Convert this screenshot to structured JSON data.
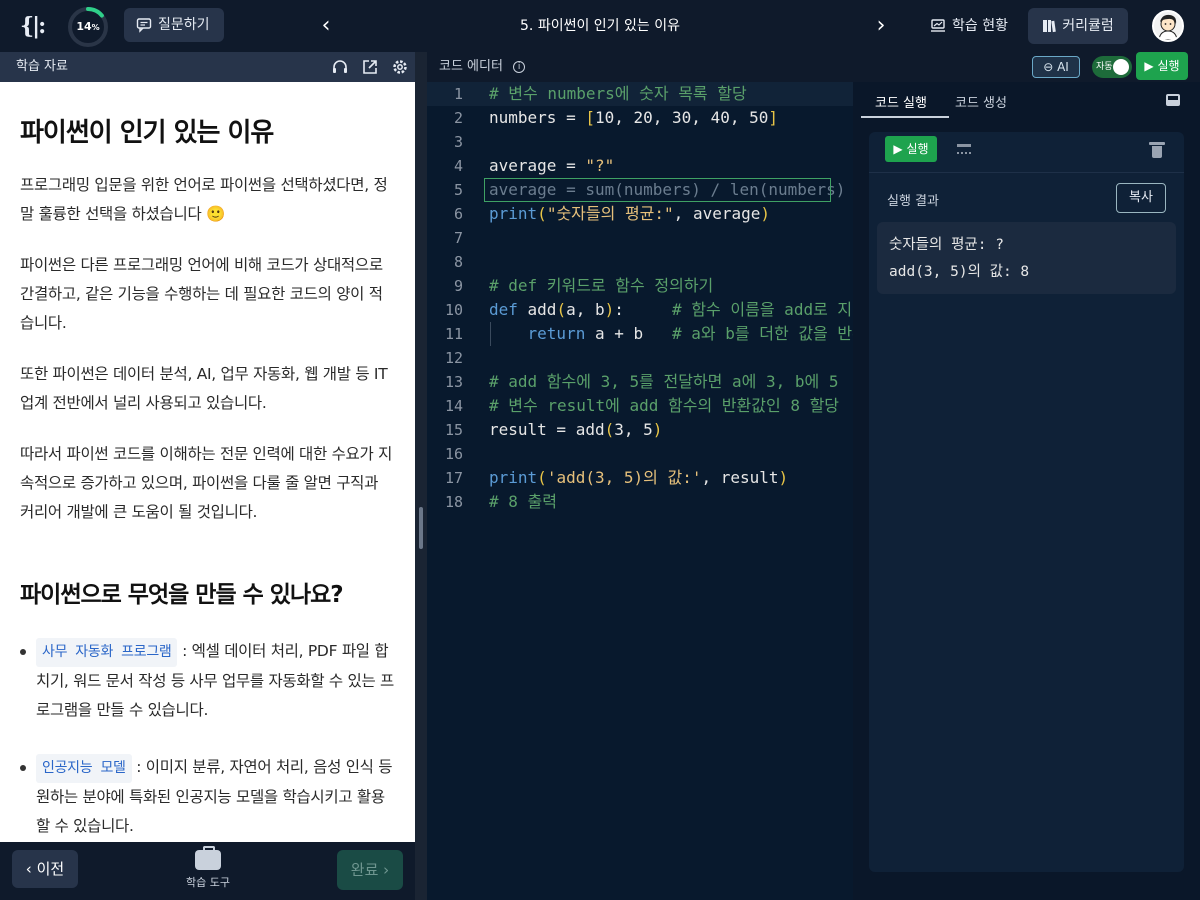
{
  "topbar": {
    "logo_text": "{|:",
    "progress": {
      "percent_value": 14,
      "label": "14",
      "unit": "%"
    },
    "ask_label": "질문하기",
    "lesson_title": "5. 파이썬이 인기 있는 이유",
    "prev_arrow": "‹",
    "next_arrow": "›",
    "status_label": "학습 현황",
    "curriculum_label": "커리큘럼"
  },
  "left_panel": {
    "header": "학습 자료",
    "title": "파이썬이 인기 있는 이유",
    "paragraphs": [
      "프로그래밍 입문을 위한 언어로 파이썬을 선택하셨다면, 정말 훌륭한 선택을 하셨습니다 🙂",
      "파이썬은 다른 프로그래밍 언어에 비해 코드가 상대적으로 간결하고, 같은 기능을 수행하는 데 필요한 코드의 양이 적습니다.",
      "또한 파이썬은 데이터 분석, AI, 업무 자동화, 웹 개발 등 IT 업계 전반에서 널리 사용되고 있습니다.",
      "따라서 파이썬 코드를 이해하는 전문 인력에 대한 수요가 지속적으로 증가하고 있으며, 파이썬을 다룰 줄 알면 구직과 커리어 개발에 큰 도움이 될 것입니다."
    ],
    "subtitle": "파이썬으로 무엇을 만들 수 있나요?",
    "bullets": [
      {
        "tag": "사무 자동화 프로그램",
        "text": " : 엑셀 데이터 처리, PDF 파일 합치기, 워드 문서 작성 등 사무 업무를 자동화할 수 있는 프로그램을 만들 수 있습니다."
      },
      {
        "tag": "인공지능 모델",
        "text": " : 이미지 분류, 자연어 처리, 음성 인식 등 원하는 분야에 특화된 인공지능 모델을 학습시키고 활용할 수 있습니다."
      }
    ],
    "footer": {
      "prev_label": "이전",
      "tools_label": "학습 도구",
      "done_label": "완료"
    }
  },
  "editor": {
    "header": "코드 에디터",
    "ai_label": "AI",
    "auto_label": "자동",
    "run_label": "실행",
    "lines": [
      {
        "n": "1"
      },
      {
        "n": "2"
      },
      {
        "n": "3"
      },
      {
        "n": "4"
      },
      {
        "n": "5"
      },
      {
        "n": "6"
      },
      {
        "n": "7"
      },
      {
        "n": "8"
      },
      {
        "n": "9"
      },
      {
        "n": "10"
      },
      {
        "n": "11"
      },
      {
        "n": "12"
      },
      {
        "n": "13"
      },
      {
        "n": "14"
      },
      {
        "n": "15"
      },
      {
        "n": "16"
      },
      {
        "n": "17"
      },
      {
        "n": "18"
      }
    ],
    "code": {
      "l1": "# 변수 numbers에 숫자 목록 할당",
      "l2_a": "numbers = ",
      "l2_b": "[",
      "l2_c": "10, 20, 30, 40, 50",
      "l2_d": "]",
      "l4_a": "average = ",
      "l4_b": "\"?\"",
      "l5": "average = sum(numbers) / len(numbers)",
      "l6_a": "print",
      "l6_b": "(",
      "l6_c": "\"숫자들의 평균:\"",
      "l6_d": ", average",
      "l6_e": ")",
      "l9": "# def 키워드로 함수 정의하기",
      "l10_a": "def",
      "l10_b": " add",
      "l10_c": "(",
      "l10_d": "a, b",
      "l10_e": ")",
      "l10_f": ":",
      "l10_g": "     # 함수 이름을 add로 지정",
      "l11_a": "    return",
      "l11_b": " a + b   ",
      "l11_c": "# a와 b를 더한 값을 반환",
      "l13": "# add 함수에 3, 5를 전달하면 a에 3, b에 5",
      "l14": "# 변수 result에 add 함수의 반환값인 8 할당",
      "l15_a": "result = add",
      "l15_b": "(",
      "l15_c": "3, 5",
      "l15_d": ")",
      "l17_a": "print",
      "l17_b": "(",
      "l17_c": "'add(3, 5)의 값:'",
      "l17_d": ", result",
      "l17_e": ")",
      "l18": "# 8 출력"
    }
  },
  "run_panel": {
    "tab_run": "코드 실행",
    "tab_gen": "코드 생성",
    "run_label": "실행",
    "result_label": "실행 결과",
    "copy_label": "복사",
    "output_lines": [
      "숫자들의 평균: ?",
      "add(3, 5)의 값: 8"
    ]
  },
  "colors": {
    "accent_green": "#1ea34e",
    "progress_ring": "#2fd08a",
    "background": "#0c1625",
    "tag_blue": "#2a66c8"
  },
  "icons": [
    "logo-icon",
    "chat-icon",
    "chevron-left-icon",
    "chevron-right-icon",
    "chart-icon",
    "book-icon",
    "headphones-icon",
    "external-link-icon",
    "gear-icon",
    "info-icon",
    "robot-icon",
    "play-icon",
    "keyboard-icon",
    "trash-icon",
    "panel-icon",
    "toolbox-icon"
  ]
}
